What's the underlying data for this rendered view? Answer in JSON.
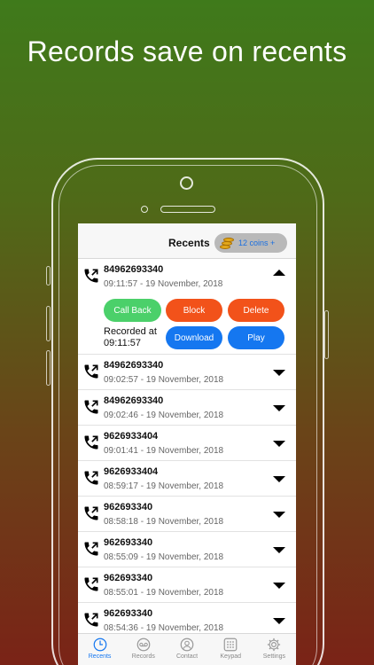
{
  "headline": "Records save on recents",
  "nav": {
    "title": "Recents",
    "coins": "12 coins +"
  },
  "expanded": {
    "number": "84962693340",
    "time": "09:11:57 - 19 November, 2018",
    "buttons": {
      "call_back": "Call Back",
      "block": "Block",
      "delete": "Delete",
      "download": "Download",
      "play": "Play"
    },
    "recorded_line1": "Recorded at",
    "recorded_line2": "09:11:57"
  },
  "calls": [
    {
      "number": "84962693340",
      "time": "09:02:57 - 19 November, 2018"
    },
    {
      "number": "84962693340",
      "time": "09:02:46 - 19 November, 2018"
    },
    {
      "number": "9626933404",
      "time": "09:01:41 - 19 November, 2018"
    },
    {
      "number": "9626933404",
      "time": "08:59:17 - 19 November, 2018"
    },
    {
      "number": "962693340",
      "time": "08:58:18 - 19 November, 2018"
    },
    {
      "number": "962693340",
      "time": "08:55:09 - 19 November, 2018"
    },
    {
      "number": "962693340",
      "time": "08:55:01 - 19 November, 2018"
    },
    {
      "number": "962693340",
      "time": "08:54:36 - 19 November, 2018"
    }
  ],
  "tabs": [
    {
      "label": "Recents",
      "icon": "clock-icon",
      "active": true
    },
    {
      "label": "Records",
      "icon": "records-icon",
      "active": false
    },
    {
      "label": "Contact",
      "icon": "contact-icon",
      "active": false
    },
    {
      "label": "Keypad",
      "icon": "keypad-icon",
      "active": false
    },
    {
      "label": "Settings",
      "icon": "gear-icon",
      "active": false
    }
  ],
  "colors": {
    "accent": "#1577f0",
    "green": "#4bd06a",
    "orange": "#f2521a"
  }
}
